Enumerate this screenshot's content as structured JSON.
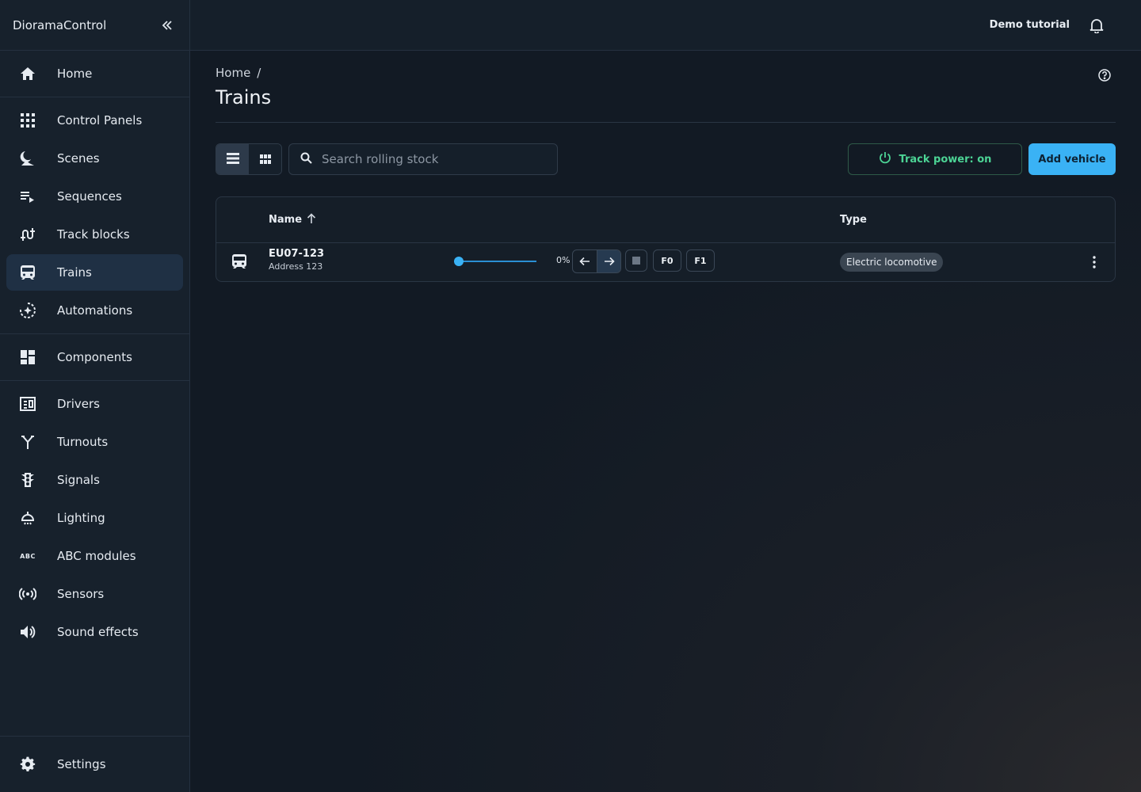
{
  "app": {
    "name": "DioramaControl"
  },
  "topbar": {
    "user": "Demo tutorial"
  },
  "sidebar": {
    "items": [
      {
        "label": "Home"
      },
      {
        "label": "Control Panels"
      },
      {
        "label": "Scenes"
      },
      {
        "label": "Sequences"
      },
      {
        "label": "Track blocks"
      },
      {
        "label": "Trains"
      },
      {
        "label": "Automations"
      },
      {
        "label": "Components"
      },
      {
        "label": "Drivers"
      },
      {
        "label": "Turnouts"
      },
      {
        "label": "Signals"
      },
      {
        "label": "Lighting"
      },
      {
        "label": "ABC modules"
      },
      {
        "label": "Sensors"
      },
      {
        "label": "Sound effects"
      }
    ],
    "settings": {
      "label": "Settings"
    },
    "active": "Trains"
  },
  "breadcrumb": {
    "home": "Home",
    "separator": "/"
  },
  "page": {
    "title": "Trains"
  },
  "search": {
    "placeholder": "Search rolling stock",
    "value": ""
  },
  "actions": {
    "track_power": "Track power: on",
    "add_vehicle": "Add vehicle"
  },
  "table": {
    "columns": {
      "name": "Name",
      "type": "Type"
    },
    "rows": [
      {
        "name": "EU07-123",
        "address": "Address 123",
        "speed": 0,
        "speed_label": "0%",
        "direction": "forward",
        "functions": [
          "F0",
          "F1"
        ],
        "type": "Electric locomotive"
      }
    ]
  },
  "colors": {
    "accent": "#3ab2f5",
    "power_on": "#4cd495",
    "background": "#121a24"
  }
}
